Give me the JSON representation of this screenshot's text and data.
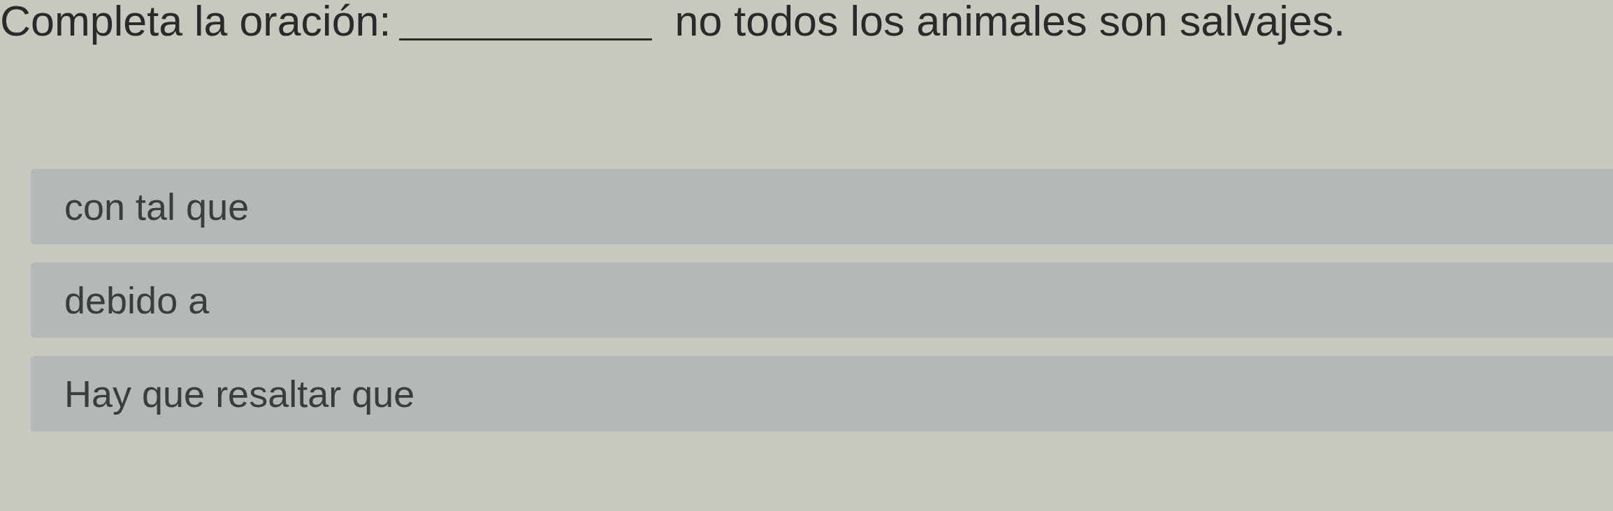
{
  "question": {
    "prompt": "Completa la oración:",
    "after_blank": "no todos los animales son salvajes."
  },
  "options": [
    {
      "label": "con tal que"
    },
    {
      "label": "debido a"
    },
    {
      "label": "Hay que resaltar que"
    }
  ]
}
